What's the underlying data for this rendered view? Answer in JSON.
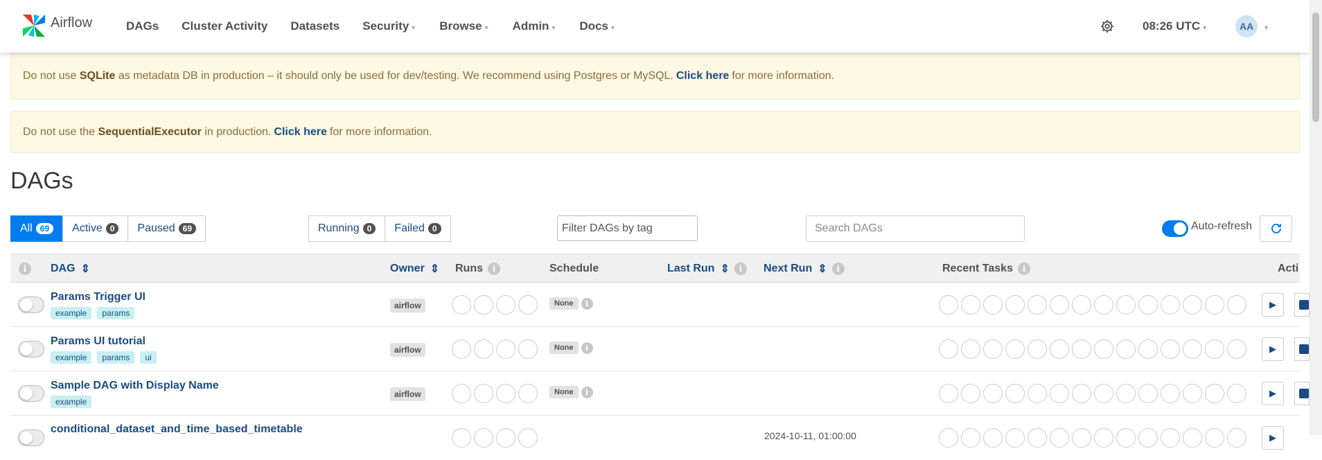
{
  "brand": {
    "name": "Airflow"
  },
  "nav": {
    "items": [
      {
        "label": "DAGs",
        "dropdown": false
      },
      {
        "label": "Cluster Activity",
        "dropdown": false
      },
      {
        "label": "Datasets",
        "dropdown": false
      },
      {
        "label": "Security",
        "dropdown": true
      },
      {
        "label": "Browse",
        "dropdown": true
      },
      {
        "label": "Admin",
        "dropdown": true
      },
      {
        "label": "Docs",
        "dropdown": true
      }
    ],
    "time": "08:26 UTC",
    "user_initials": "AA"
  },
  "alerts": {
    "sqlite": {
      "prefix": "Do not use ",
      "keyword": "SQLite",
      "middle": " as metadata DB in production – it should only be used for dev/testing. We recommend using Postgres or MySQL.",
      "link": "Click here",
      "suffix": "for more information."
    },
    "executor": {
      "prefix": "Do not use the ",
      "keyword": "SequentialExecutor",
      "middle": " in production.",
      "link": "Click here",
      "suffix": "for more information."
    }
  },
  "page": {
    "title": "DAGs"
  },
  "status_filters": {
    "all": {
      "label": "All",
      "count": "69"
    },
    "active": {
      "label": "Active",
      "count": "0"
    },
    "paused": {
      "label": "Paused",
      "count": "69"
    },
    "running": {
      "label": "Running",
      "count": "0"
    },
    "failed": {
      "label": "Failed",
      "count": "0"
    }
  },
  "tag_filter": {
    "placeholder": "Filter DAGs by tag"
  },
  "search": {
    "placeholder": "Search DAGs"
  },
  "auto_refresh": {
    "label": "Auto-refresh",
    "enabled": true
  },
  "table": {
    "headers": {
      "dag": "DAG",
      "owner": "Owner",
      "runs": "Runs",
      "schedule": "Schedule",
      "last_run": "Last Run",
      "next_run": "Next Run",
      "recent_tasks": "Recent Tasks",
      "actions": "Acti"
    },
    "rows": [
      {
        "name": "Params Trigger UI",
        "tags": [
          "example",
          "params"
        ],
        "owner": "airflow",
        "schedule": "None",
        "next_run": ""
      },
      {
        "name": "Params UI tutorial",
        "tags": [
          "example",
          "params",
          "ui"
        ],
        "owner": "airflow",
        "schedule": "None",
        "next_run": ""
      },
      {
        "name": "Sample DAG with Display Name",
        "tags": [
          "example"
        ],
        "owner": "airflow",
        "schedule": "None",
        "next_run": ""
      },
      {
        "name": "conditional_dataset_and_time_based_timetable",
        "tags": [],
        "owner": "",
        "schedule": "",
        "next_run": "2024-10-11, 01:00:00"
      }
    ]
  },
  "colors": {
    "accent": "#017cee",
    "link": "#1a4b84",
    "alert_bg": "#fcf8e3",
    "tag_bg": "#c8eff2"
  }
}
